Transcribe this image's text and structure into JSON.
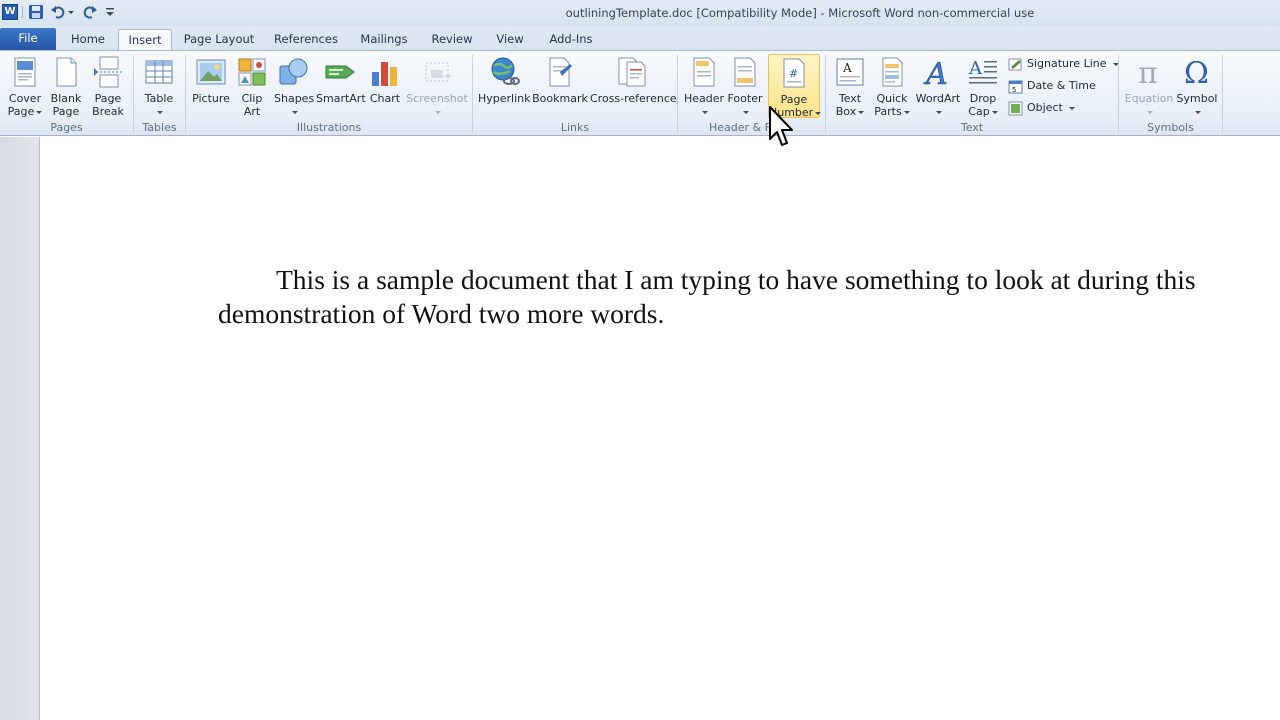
{
  "window": {
    "title": "outliningTemplate.doc [Compatibility Mode]  -  Microsoft Word non-commercial use"
  },
  "quick_access": {
    "icons": [
      "word-logo-icon",
      "save-icon",
      "undo-icon",
      "redo-icon",
      "customize-dropdown-icon"
    ]
  },
  "tabs": [
    "File",
    "Home",
    "Insert",
    "Page Layout",
    "References",
    "Mailings",
    "Review",
    "View",
    "Add-Ins"
  ],
  "active_tab": "Insert",
  "ribbon": {
    "pages": {
      "label": "Pages",
      "cover_page": [
        "Cover",
        "Page"
      ],
      "blank_page": [
        "Blank",
        "Page"
      ],
      "page_break": [
        "Page",
        "Break"
      ]
    },
    "tables": {
      "label": "Tables",
      "table": "Table"
    },
    "illustrations": {
      "label": "Illustrations",
      "picture": "Picture",
      "clip_art": [
        "Clip",
        "Art"
      ],
      "shapes": "Shapes",
      "smartart": "SmartArt",
      "chart": "Chart",
      "screenshot": "Screenshot"
    },
    "links": {
      "label": "Links",
      "hyperlink": "Hyperlink",
      "bookmark": "Bookmark",
      "cross_reference": "Cross-reference"
    },
    "header_footer": {
      "label": "Header & F",
      "header": "Header",
      "footer": "Footer",
      "page_number": [
        "Page",
        "Number"
      ]
    },
    "text": {
      "label": "Text",
      "text_box": [
        "Text",
        "Box"
      ],
      "quick_parts": [
        "Quick",
        "Parts"
      ],
      "wordart": "WordArt",
      "drop_cap": [
        "Drop",
        "Cap"
      ],
      "signature_line": "Signature Line",
      "date_time": "Date & Time",
      "object": "Object"
    },
    "symbols": {
      "label": "Symbols",
      "equation": "Equation",
      "symbol": "Symbol"
    }
  },
  "document": {
    "line1": "This is a sample document that I am typing to have something to look at during this",
    "line2": "demonstration of Word two more words."
  },
  "colors": {
    "file_tab": "#2a5eb0",
    "ribbon_bg": "#e8eff8",
    "hover_highlight": "#ffe38a"
  }
}
